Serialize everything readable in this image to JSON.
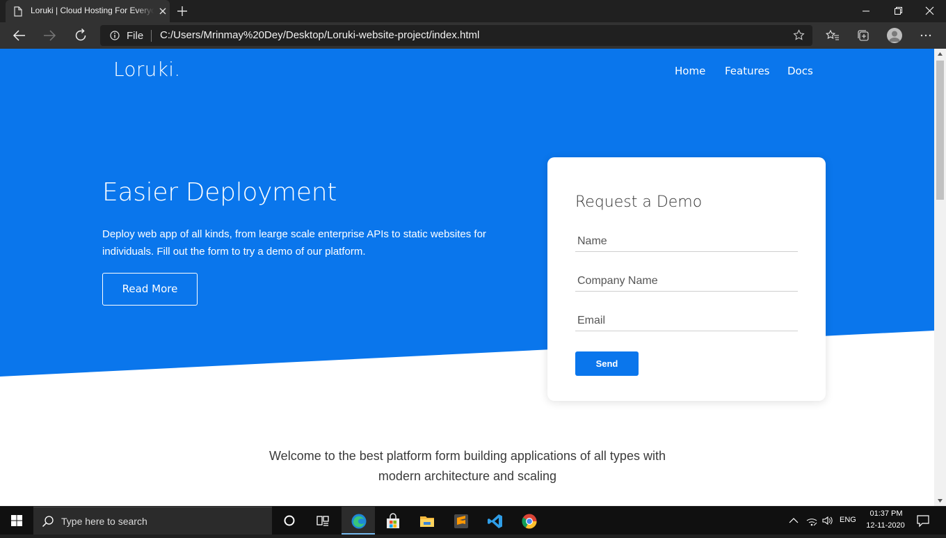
{
  "browser": {
    "tab_title": "Loruki | Cloud Hosting For Everyone",
    "address_scheme": "File",
    "url": "C:/Users/Mrinmay%20Dey/Desktop/Loruki-website-project/index.html"
  },
  "page": {
    "logo": "Loruki.",
    "nav": [
      "Home",
      "Features",
      "Docs"
    ],
    "hero_title": "Easier Deployment",
    "hero_text": "Deploy web app of all kinds, from learge scale enterprise APIs to static websites for individuals. Fill out the form to try a demo of our platform.",
    "read_more_label": "Read More",
    "form": {
      "title": "Request a Demo",
      "name_placeholder": "Name",
      "company_placeholder": "Company Name",
      "email_placeholder": "Email",
      "send_label": "Send"
    },
    "welcome_text": "Welcome to the best platform form building applications of all types with modern architecture and scaling"
  },
  "taskbar": {
    "search_placeholder": "Type here to search",
    "language": "ENG",
    "time": "01:37 PM",
    "date": "12-11-2020"
  },
  "colors": {
    "brand_blue": "#0a76ec",
    "chrome_dark": "#202020",
    "chrome_toolbar": "#323232"
  }
}
